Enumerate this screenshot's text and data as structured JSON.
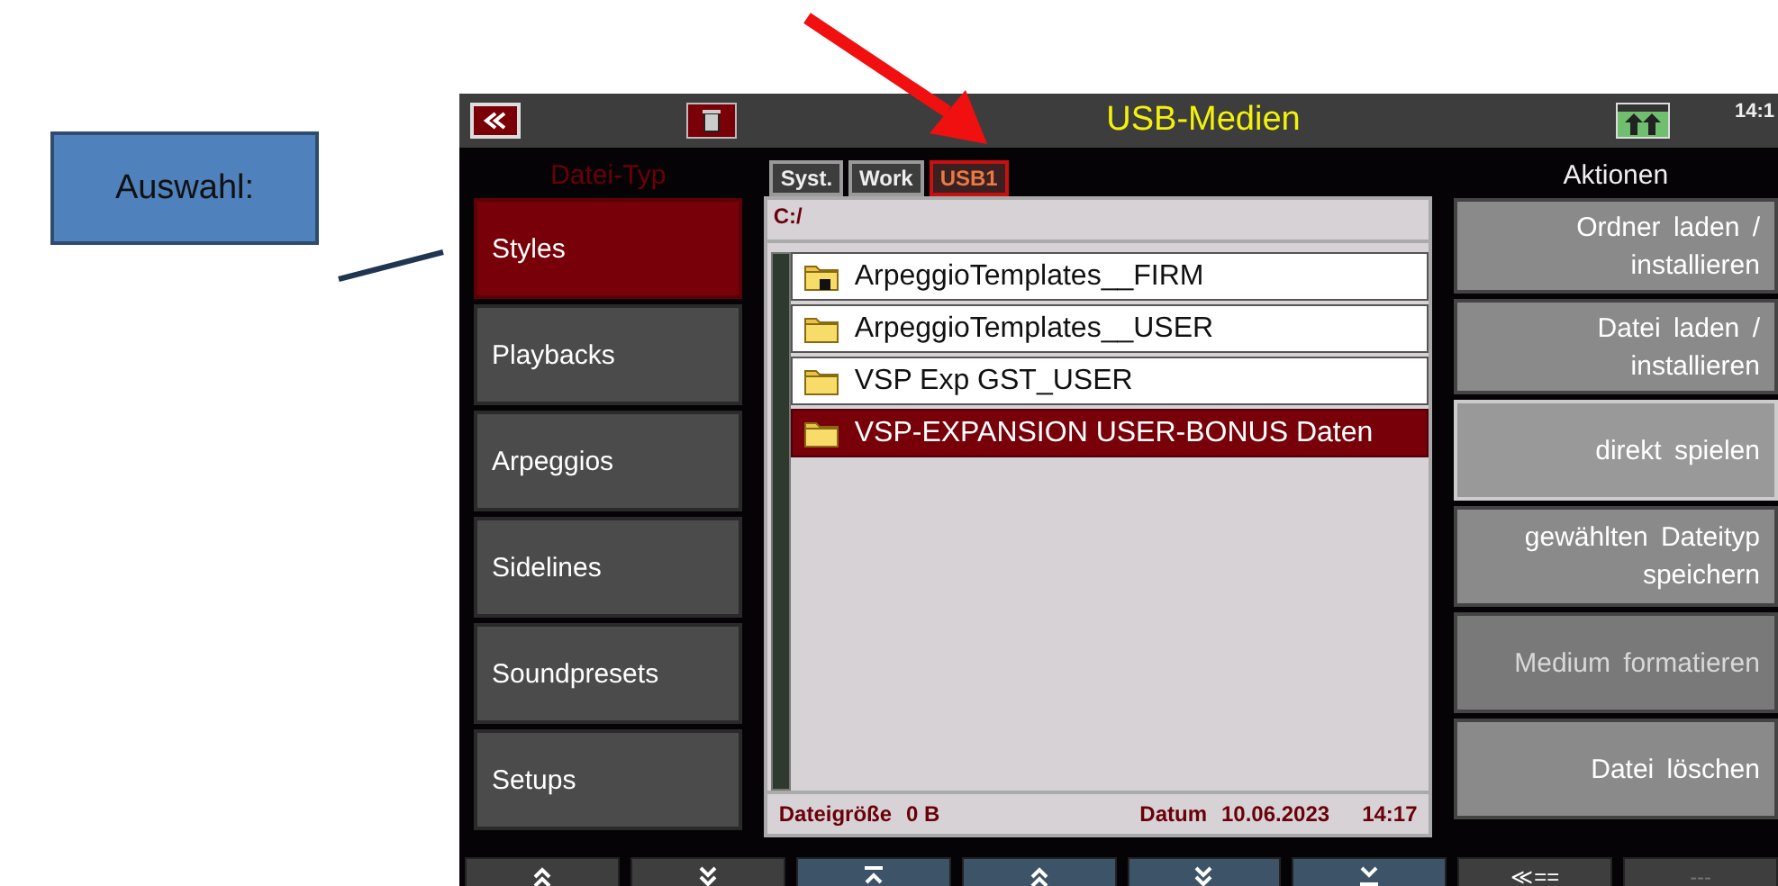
{
  "annotation": {
    "callout": "Auswahl:"
  },
  "top_bar": {
    "title": "USB-Medien",
    "time": "14:1"
  },
  "file_types": {
    "header": "Datei-Typ",
    "items": [
      {
        "label": "Styles",
        "selected": true
      },
      {
        "label": "Playbacks",
        "selected": false
      },
      {
        "label": "Arpeggios",
        "selected": false
      },
      {
        "label": "Sidelines",
        "selected": false
      },
      {
        "label": "Soundpresets",
        "selected": false
      },
      {
        "label": "Setups",
        "selected": false
      }
    ]
  },
  "tabs": [
    {
      "label": "Syst.",
      "selected": false
    },
    {
      "label": "Work",
      "selected": false
    },
    {
      "label": "USB1",
      "selected": true
    }
  ],
  "browser": {
    "path": "C:/",
    "rows": [
      {
        "name": "ArpeggioTemplates__FIRM",
        "locked": true,
        "selected": false
      },
      {
        "name": "ArpeggioTemplates__USER",
        "locked": false,
        "selected": false
      },
      {
        "name": "VSP Exp GST_USER",
        "locked": false,
        "selected": false
      },
      {
        "name": "VSP-EXPANSION USER-BONUS Daten",
        "locked": false,
        "selected": true
      }
    ],
    "size_label": "Dateigröße",
    "size": "0 B",
    "date_label": "Datum",
    "date": "10.06.2023",
    "time": "14:17"
  },
  "actions": {
    "header": "Aktionen",
    "items": [
      {
        "label": "Ordner laden /\ninstallieren",
        "selected": false,
        "disabled": false
      },
      {
        "label": "Datei laden /\ninstallieren",
        "selected": false,
        "disabled": false
      },
      {
        "label": "direkt spielen",
        "selected": true,
        "disabled": false
      },
      {
        "label": "gewählten Dateityp\nspeichern",
        "selected": false,
        "disabled": false
      },
      {
        "label": "Medium formatieren",
        "selected": false,
        "disabled": true
      },
      {
        "label": "Datei löschen",
        "selected": false,
        "disabled": false
      }
    ]
  },
  "bottom_buttons": [
    {
      "kind": "up",
      "color": "#3e3e3e"
    },
    {
      "kind": "down",
      "color": "#3e3e3e"
    },
    {
      "kind": "top",
      "color": "#3d5468"
    },
    {
      "kind": "up",
      "color": "#3d5468"
    },
    {
      "kind": "down",
      "color": "#3d5468"
    },
    {
      "kind": "bottom",
      "color": "#3d5468"
    },
    {
      "kind": "text",
      "label": "≪==",
      "color": "#3e3e3e",
      "disabled": false
    },
    {
      "kind": "text",
      "label": "---",
      "color": "#3e3e3e",
      "disabled": true
    }
  ]
}
